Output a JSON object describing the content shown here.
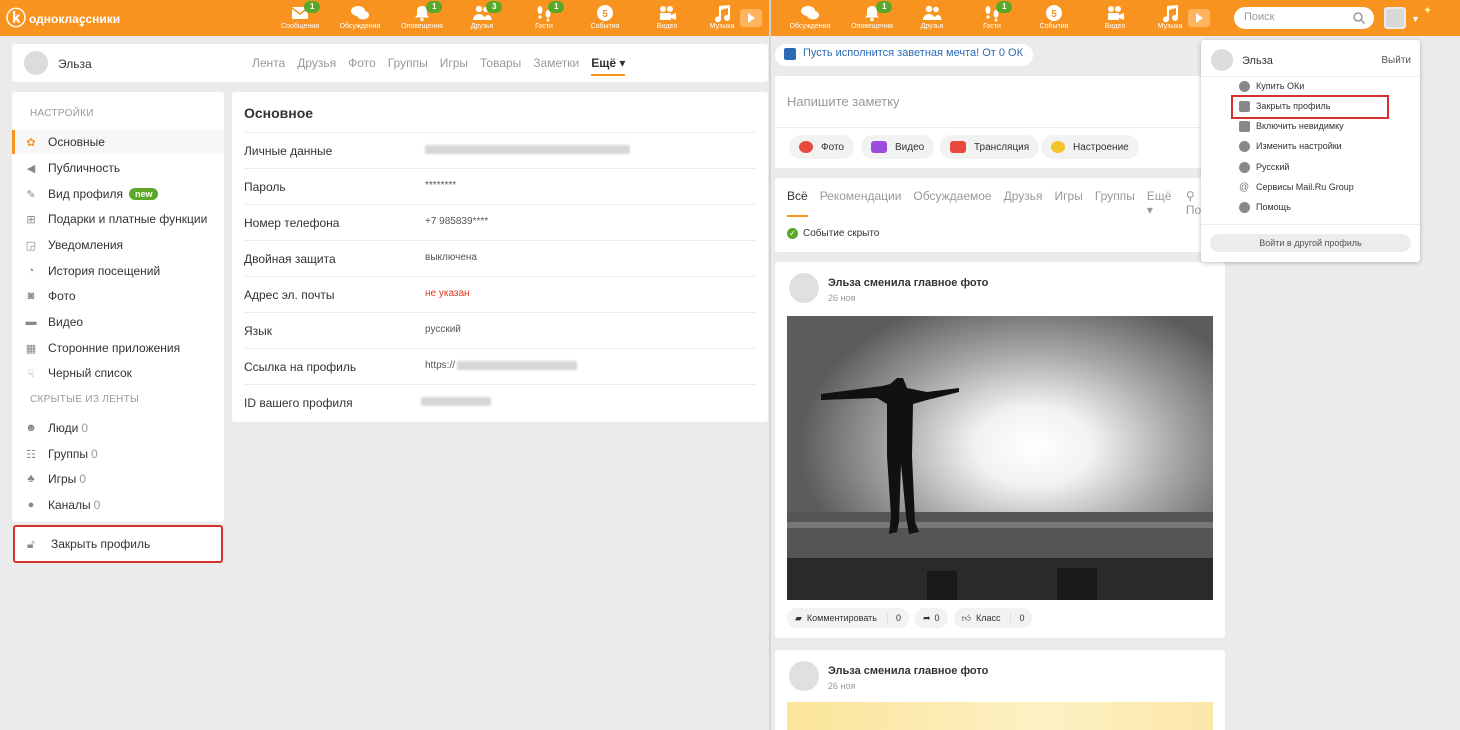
{
  "brand": {
    "name": "одноклассники",
    "accent": "#f7931e"
  },
  "left_nav": [
    {
      "label": "Сообщения",
      "badge": "1",
      "icon": "envelope-icon"
    },
    {
      "label": "Обсуждения",
      "badge": "",
      "icon": "discussions-icon"
    },
    {
      "label": "Оповещения",
      "badge": "1",
      "icon": "bell-icon"
    },
    {
      "label": "Друзья",
      "badge": "3",
      "icon": "friends-icon"
    },
    {
      "label": "Гости",
      "badge": "1",
      "icon": "footprints-icon"
    },
    {
      "label": "События",
      "badge": "",
      "count": "5",
      "icon": "events-icon"
    },
    {
      "label": "Видео",
      "badge": "",
      "icon": "video-camera-icon"
    },
    {
      "label": "Музыка",
      "badge": "",
      "icon": "music-note-icon"
    }
  ],
  "right_nav": [
    {
      "label": "Обсуждения",
      "badge": "",
      "icon": "discussions-icon"
    },
    {
      "label": "Оповещения",
      "badge": "1",
      "icon": "bell-icon"
    },
    {
      "label": "Друзья",
      "badge": "",
      "icon": "friends-icon"
    },
    {
      "label": "Гости",
      "badge": "1",
      "icon": "footprints-icon"
    },
    {
      "label": "События",
      "badge": "",
      "count": "5",
      "icon": "events-icon"
    },
    {
      "label": "Видео",
      "badge": "",
      "icon": "video-camera-icon"
    },
    {
      "label": "Музыка",
      "badge": "",
      "icon": "music-note-icon"
    }
  ],
  "search": {
    "placeholder": "Поиск"
  },
  "profile_bar": {
    "name": "Эльза",
    "tabs": [
      "Лента",
      "Друзья",
      "Фото",
      "Группы",
      "Игры",
      "Товары",
      "Заметки"
    ],
    "more": "Ещё"
  },
  "settings_sidebar": {
    "section_settings": "Настройки",
    "items": [
      {
        "label": "Основные",
        "icon": "gear-icon",
        "active": true
      },
      {
        "label": "Публичность",
        "icon": "megaphone-icon"
      },
      {
        "label": "Вид профиля",
        "icon": "brush-icon",
        "badge": "new"
      },
      {
        "label": "Подарки и платные функции",
        "icon": "gift-icon"
      },
      {
        "label": "Уведомления",
        "icon": "notification-icon"
      },
      {
        "label": "История посещений",
        "icon": "history-icon"
      },
      {
        "label": "Фото",
        "icon": "camera-icon"
      },
      {
        "label": "Видео",
        "icon": "video-icon"
      },
      {
        "label": "Сторонние приложения",
        "icon": "apps-grid-icon"
      },
      {
        "label": "Черный список",
        "icon": "thumbs-down-icon"
      }
    ],
    "section_hidden": "Скрытые из ленты",
    "hidden": [
      {
        "label": "Люди",
        "count": "0",
        "icon": "people-icon"
      },
      {
        "label": "Группы",
        "count": "0",
        "icon": "groups-icon"
      },
      {
        "label": "Игры",
        "count": "0",
        "icon": "gamepad-icon"
      },
      {
        "label": "Каналы",
        "count": "0",
        "icon": "channel-icon"
      }
    ],
    "close_profile": "Закрыть профиль"
  },
  "settings_main": {
    "title": "Основное",
    "rows": [
      {
        "label": "Личные данные",
        "value": ""
      },
      {
        "label": "Пароль",
        "value": "********"
      },
      {
        "label": "Номер телефона",
        "value": "+7 985839****"
      },
      {
        "label": "Двойная защита",
        "value": "выключена"
      },
      {
        "label": "Адрес эл. почты",
        "value": "не указан"
      },
      {
        "label": "Язык",
        "value": "русский"
      },
      {
        "label": "Ссылка на профиль",
        "value": "https://"
      },
      {
        "label": "ID вашего профиля",
        "value": ""
      }
    ]
  },
  "announcement": "Пусть исполнится заветная мечта! От 0 ОК",
  "note": {
    "placeholder": "Напишите заметку",
    "buttons": [
      "Фото",
      "Видео",
      "Трансляция",
      "Настроение"
    ]
  },
  "feed": {
    "tabs": [
      "Всё",
      "Рекомендации",
      "Обсуждаемое",
      "Друзья",
      "Игры",
      "Группы",
      "Ещё",
      "Пои"
    ],
    "status": "Событие скрыто"
  },
  "posts": [
    {
      "title": "Эльза сменила главное фото",
      "date": "26 ноя",
      "comment_label": "Комментировать",
      "comments": "0",
      "shares": "0",
      "like_label": "Класс",
      "likes": "0"
    },
    {
      "title": "Эльза сменила главное фото",
      "date": "26 ноя"
    }
  ],
  "dropdown": {
    "name": "Эльза",
    "logout": "Выйти",
    "items": [
      "Купить ОКи",
      "Закрыть профиль",
      "Включить невидимку",
      "Изменить настройки",
      "Русский",
      "Сервисы Mail.Ru Group",
      "Помощь"
    ],
    "switch_profile": "Войти в другой профиль"
  },
  "colors": {
    "badge_green": "#5ba829",
    "highlight_red": "#d63030",
    "link_blue": "#2a6ab5"
  }
}
